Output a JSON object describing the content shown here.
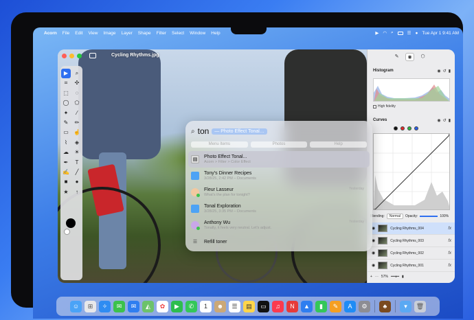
{
  "menubar": {
    "app_name": "Acorn",
    "menus": [
      "File",
      "Edit",
      "View",
      "Image",
      "Layer",
      "Shape",
      "Filter",
      "Select",
      "Window",
      "Help"
    ],
    "clock": "Tue Apr 1  9:41 AM"
  },
  "window": {
    "title": "Cycling Rhythms.jpg"
  },
  "inspector": {
    "histogram_title": "Histogram",
    "high_fidelity_label": "High fidelity",
    "curves_title": "Curves",
    "blending_label": "Blending:",
    "blending_value": "Normal",
    "opacity_label": "Opacity:",
    "opacity_value": "100%",
    "layers": [
      {
        "name": "Cycling Rhythms_004",
        "selected": true
      },
      {
        "name": "Cycling Rhythms_003",
        "selected": false
      },
      {
        "name": "Cycling Rhythms_002",
        "selected": false
      },
      {
        "name": "Cycling Rhythms_001",
        "selected": false
      }
    ],
    "zoom": "57%"
  },
  "spotlight": {
    "query": "ton",
    "suggestion": "— Photo Effect Tonal…",
    "categories": [
      "Menu Items",
      "Photos",
      "Help"
    ],
    "results": [
      {
        "title": "Photo Effect Tonal...",
        "subtitle": "Acorn > Filter > Color Effect",
        "date": ""
      },
      {
        "title": "Tony's Dinner Recipes",
        "subtitle": "3/28/25, 2:42 PM – Documents",
        "date": ""
      },
      {
        "title": "Fleur Lasseur",
        "subtitle": "What's the plan for tonight?",
        "date": "Yesterday"
      },
      {
        "title": "Tonal Exploration",
        "subtitle": "3/28/25, 3:35 PM – Documents",
        "date": ""
      },
      {
        "title": "Anthony Wu",
        "subtitle": "Tonally, it feels very neutral. Let's adjust.",
        "date": "Yesterday"
      },
      {
        "title": "Refill toner",
        "subtitle": "",
        "date": ""
      }
    ]
  },
  "colors": {
    "accent": "#2f6ff0",
    "close": "#ff5f57",
    "minimize": "#febc2e",
    "zoom": "#28c840"
  }
}
